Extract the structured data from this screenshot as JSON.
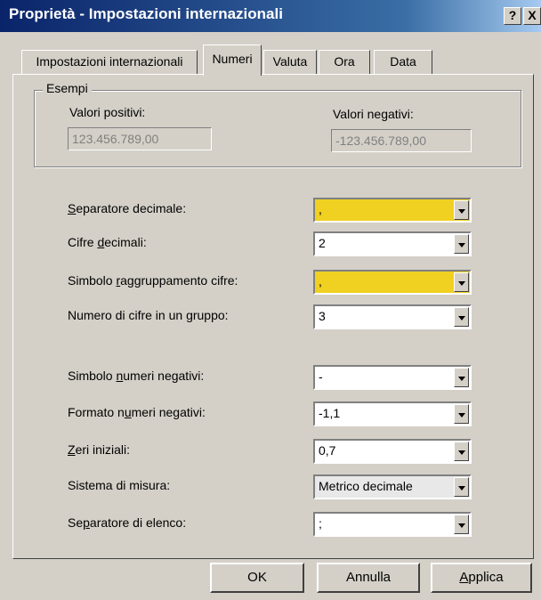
{
  "window": {
    "title": "Proprietà - Impostazioni internazionali",
    "help_label": "?",
    "close_label": "X"
  },
  "tabs": [
    {
      "label": "Impostazioni internazionali"
    },
    {
      "label": "Numeri"
    },
    {
      "label": "Valuta"
    },
    {
      "label": "Ora"
    },
    {
      "label": "Data"
    }
  ],
  "examples": {
    "label": "Esempi",
    "positive_label": "Valori positivi:",
    "positive_value": "123.456.789,00",
    "negative_label": "Valori negativi:",
    "negative_value": "-123.456.789,00"
  },
  "settings": [
    {
      "pre": "",
      "acc": "S",
      "post": "eparatore decimale:",
      "value": ","
    },
    {
      "pre": "Cifre ",
      "acc": "d",
      "post": "ecimali:",
      "value": "2"
    },
    {
      "pre": "Simbolo ",
      "acc": "r",
      "post": "aggruppamento cifre:",
      "value": ","
    },
    {
      "pre": "Numero di cifre in un ",
      "acc": "g",
      "post": "ruppo:",
      "value": "3"
    },
    {
      "pre": "Simbolo ",
      "acc": "n",
      "post": "umeri negativi:",
      "value": "-"
    },
    {
      "pre": "Formato n",
      "acc": "u",
      "post": "meri negativi:",
      "value": "-1,1"
    },
    {
      "pre": "",
      "acc": "Z",
      "post": "eri iniziali:",
      "value": "0,7"
    },
    {
      "pre": "Sistema di misura:",
      "acc": "",
      "post": "",
      "value": "Metrico decimale"
    },
    {
      "pre": "Se",
      "acc": "p",
      "post": "aratore di elenco:",
      "value": ";"
    }
  ],
  "buttons": {
    "ok": "OK",
    "cancel": "Annulla",
    "apply_acc": "A",
    "apply_rest": "pplica"
  }
}
